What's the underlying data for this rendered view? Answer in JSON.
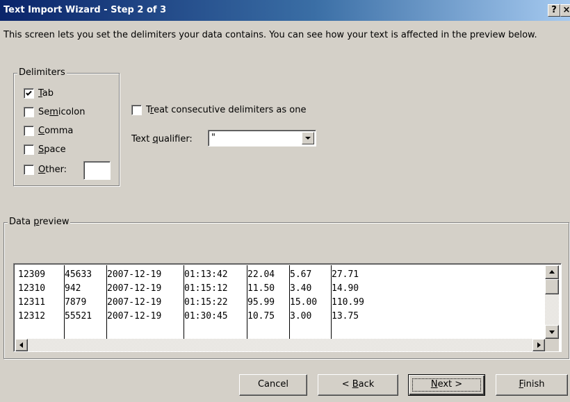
{
  "window": {
    "title": "Text Import Wizard - Step 2 of 3",
    "help_label": "?",
    "close_label": "×"
  },
  "description": "This screen lets you set the delimiters your data contains.  You can see how your text is affected in the preview below.",
  "delimiters": {
    "group_label": "Delimiters",
    "items": [
      {
        "pre": "",
        "key": "T",
        "post": "ab",
        "checked": true
      },
      {
        "pre": "Se",
        "key": "m",
        "post": "icolon",
        "checked": false
      },
      {
        "pre": "",
        "key": "C",
        "post": "omma",
        "checked": false
      },
      {
        "pre": "",
        "key": "S",
        "post": "pace",
        "checked": false
      },
      {
        "pre": "",
        "key": "O",
        "post": "ther:",
        "checked": false
      }
    ],
    "other_value": ""
  },
  "consecutive": {
    "pre": "T",
    "key": "r",
    "post": "eat consecutive delimiters as one",
    "checked": false
  },
  "qualifier": {
    "label_pre": "Text ",
    "label_key": "q",
    "label_post": "ualifier:",
    "value": "\""
  },
  "preview": {
    "group_pre": "Data ",
    "group_key": "p",
    "group_post": "review",
    "rows": [
      [
        "12309",
        "45633",
        "2007-12-19",
        "01:13:42",
        "22.04",
        "5.67",
        "27.71"
      ],
      [
        "12310",
        "942",
        "2007-12-19",
        "01:15:12",
        "11.50",
        "3.40",
        "14.90"
      ],
      [
        "12311",
        "7879",
        "2007-12-19",
        "01:15:22",
        "95.99",
        "15.00",
        "110.99"
      ],
      [
        "12312",
        "55521",
        "2007-12-19",
        "01:30:45",
        "10.75",
        "3.00",
        "13.75"
      ]
    ]
  },
  "buttons": {
    "cancel": "Cancel",
    "back_pre": "< ",
    "back_key": "B",
    "back_post": "ack",
    "next_pre": "",
    "next_key": "N",
    "next_post": "ext >",
    "finish_pre": "",
    "finish_key": "F",
    "finish_post": "inish"
  }
}
